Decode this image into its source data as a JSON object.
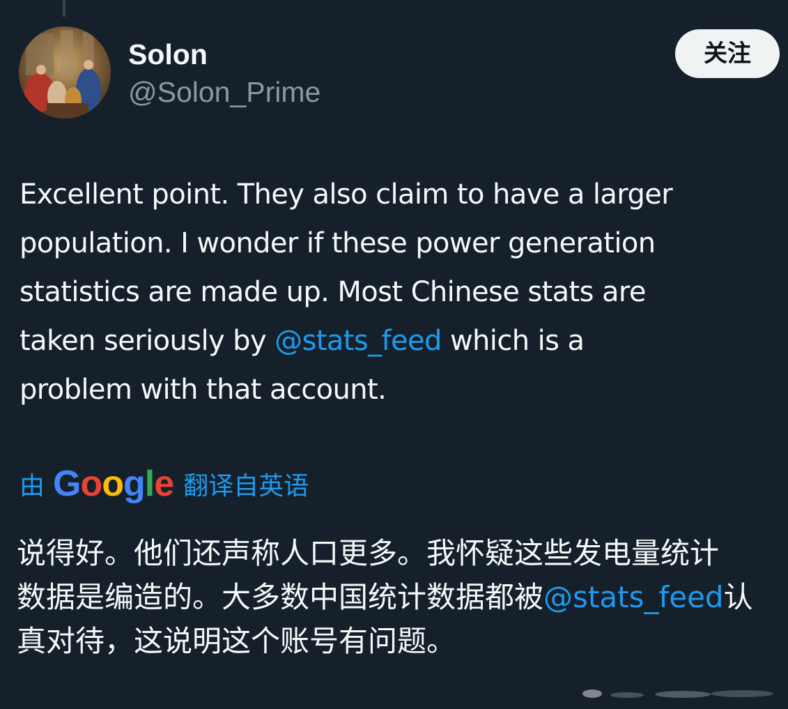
{
  "author": {
    "display_name": "Solon",
    "handle": "@Solon_Prime"
  },
  "follow_button": {
    "label": "关注"
  },
  "tweet": {
    "lines": [
      "Excellent point.   They also claim to have a larger",
      "population.  I wonder if these power generation",
      "statistics are made up.  Most Chinese stats are"
    ],
    "line4_before": "taken seriously by ",
    "mention": "@stats_feed",
    "line4_after": " which is a",
    "line5": "problem with that account."
  },
  "translation": {
    "prefix": "由",
    "provider_letters": [
      "G",
      "o",
      "o",
      "g",
      "l",
      "e"
    ],
    "suffix": "翻译自英语",
    "line1": "说得好。他们还声称人口更多。我怀疑这些发电量统计",
    "line2_before": "数据是编造的。大多数中国统计数据都被",
    "line2_mention": "@stats_feed",
    "line2_after": "认",
    "line3": "真对待，这说明这个账号有问题。"
  },
  "colors": {
    "background": "#15202b",
    "link": "#1d9bf0",
    "secondary_text": "#8b98a5",
    "primary_text": "#f7f9f9",
    "button_bg": "#eff3f4"
  }
}
